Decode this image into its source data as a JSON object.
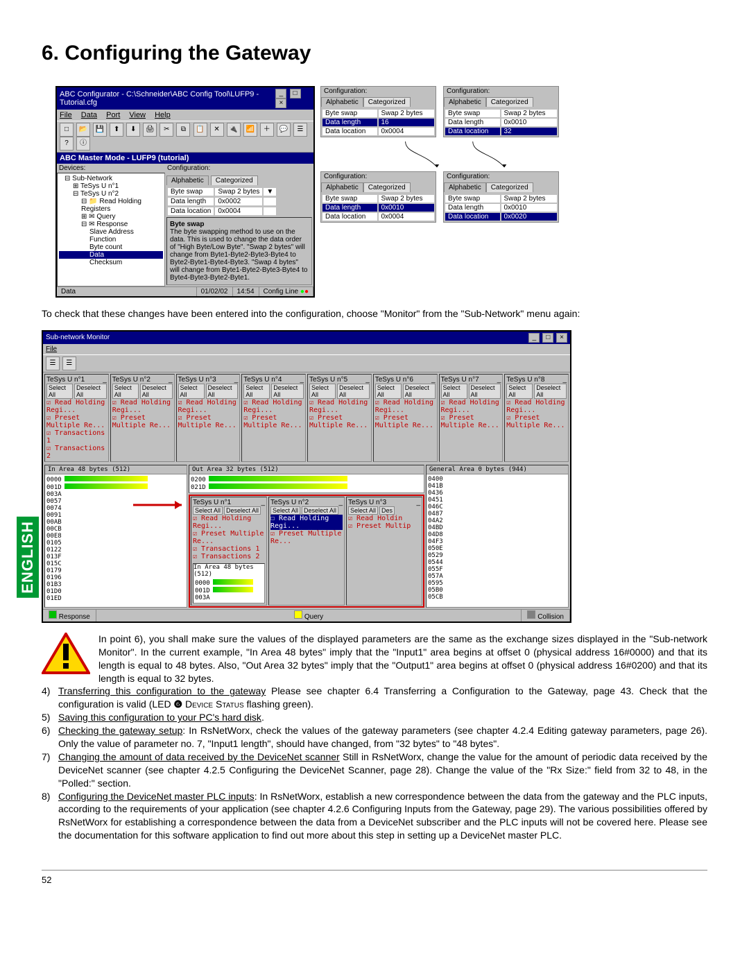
{
  "page": {
    "title": "6. Configuring the Gateway",
    "number": "52",
    "tab": "ENGLISH"
  },
  "abc_window": {
    "title": "ABC Configurator - C:\\Schneider\\ABC Config Tool\\LUFP9 - Tutorial.cfg",
    "menu": [
      "File",
      "Data",
      "Port",
      "View",
      "Help"
    ],
    "mode": "ABC Master Mode - LUFP9 (tutorial)",
    "devices_header": "Devices:",
    "config_header": "Configuration:",
    "tree": {
      "root": "Sub-Network",
      "n1": "TeSys U n°1",
      "n2": "TeSys U n°2",
      "rhr": "Read Holding Registers",
      "query": "Query",
      "response": "Response",
      "slave": "Slave Address",
      "func": "Function",
      "bytecount": "Byte count",
      "data": "Data",
      "checksum": "Checksum"
    },
    "tabs": {
      "a": "Alphabetic",
      "b": "Categorized"
    },
    "kv": {
      "k1": "Byte swap",
      "v1": "Swap 2 bytes",
      "k2": "Data length",
      "v2": "0x0002",
      "k3": "Data location",
      "v3": "0x0004"
    },
    "desc_title": "Byte swap",
    "desc_text": "The byte swapping method to use on the data. This is used to change the data order of \"High Byte/Low Byte\". \"Swap 2 bytes\" will change from Byte1-Byte2-Byte3-Byte4 to Byte2-Byte1-Byte4-Byte3. \"Swap 4 bytes\" will change from Byte1-Byte2-Byte3-Byte4 to Byte4-Byte3-Byte2-Byte1.",
    "status": {
      "left": "Data",
      "date": "01/02/02",
      "time": "14:54",
      "right": "Config Line"
    }
  },
  "minis": [
    {
      "hdr": "Configuration:",
      "byte_swap": "Swap 2 bytes",
      "data_length": "16",
      "data_location": "0x0004",
      "highlight": "data_length"
    },
    {
      "hdr": "Configuration:",
      "byte_swap": "Swap 2 bytes",
      "data_length": "0x0010",
      "data_location": "32",
      "highlight": "data_location"
    },
    {
      "hdr": "Configuration:",
      "byte_swap": "Swap 2 bytes",
      "data_length": "0x0010",
      "data_location": "0x0004",
      "highlight": "data_length"
    },
    {
      "hdr": "Configuration:",
      "byte_swap": "Swap 2 bytes",
      "data_length": "0x0010",
      "data_location": "0x0020",
      "highlight": "data_location"
    }
  ],
  "mini_labels": {
    "byte_swap": "Byte swap",
    "data_length": "Data length",
    "data_location": "Data location"
  },
  "intro_text": "To check that these changes have been entered into the configuration, choose \"Monitor\" from the \"Sub-Network\" menu again:",
  "monitor": {
    "title": "Sub-network Monitor",
    "menu": [
      "File"
    ],
    "colnames": [
      "TeSys U n°1",
      "TeSys U n°2",
      "TeSys U n°3",
      "TeSys U n°4",
      "TeSys U n°5",
      "TeSys U n°6",
      "TeSys U n°7",
      "TeSys U n°8"
    ],
    "select_all": "Select All",
    "deselect_all": "Deselect All",
    "items": {
      "rhr": "Read Holding Regi...",
      "pmr": "Preset Multiple Re...",
      "t1": "Transactions 1",
      "t2": "Transactions 2"
    },
    "lower": {
      "in_hdr": "In Area 48 bytes (512)",
      "out_hdr": "Out Area 32 bytes (512)",
      "gen_hdr": "General Area 0 bytes (944)",
      "in_addrs": [
        "0000",
        "001D",
        "003A",
        "0057",
        "0074",
        "0091",
        "00AB",
        "00CB",
        "00E8",
        "0105",
        "0122",
        "013F",
        "015C",
        "0179",
        "0196",
        "01B3",
        "01D0",
        "01ED"
      ],
      "out_addrs": [
        "0200",
        "021D"
      ],
      "gen_addrs": [
        "0400",
        "041B",
        "0436",
        "0451",
        "046C",
        "0487",
        "04A2",
        "04BD",
        "04D8",
        "04F3",
        "050E",
        "0529",
        "0544",
        "055F",
        "057A",
        "0595",
        "05B0",
        "05CB"
      ]
    },
    "highlight_cols": [
      "TeSys U n°1",
      "TeSys U n°2",
      "TeSys U n°3"
    ],
    "highlight_inner": {
      "in_hdr": "In Area 48 bytes (512)",
      "in_addrs": [
        "0000",
        "001D",
        "003A"
      ]
    },
    "status": {
      "response": "Response",
      "query": "Query",
      "collision": "Collision"
    }
  },
  "point6_text": "In point 6), you shall make sure the values of the displayed parameters are the same as the exchange sizes displayed in the \"Sub-network Monitor\". In the current example, \"In Area 48 bytes\" imply that the \"Input1\" area begins at offset 0 (physical address 16#0000) and that its length is equal to 48 bytes. Also, \"Out Area 32 bytes\" imply that the \"Output1\" area begins at offset 0 (physical address 16#0200) and that its length is equal to 32 bytes.",
  "steps": {
    "s4a": "Transferring this configuration to the gateway",
    "s4b": " Please see chapter 6.4 Transferring  a Configuration to the Gateway, page 43. Check that the configuration is valid (LED ",
    "s4c": " Device Status",
    "s4d": " flashing green).",
    "s5": "Saving this configuration to your PC's hard disk",
    "s6a": "Checking the gateway setup",
    "s6b": ": In RsNetWorx, check the values of the gateway parameters (see chapter 4.2.4 Editing gateway parameters, page 26). Only the value of parameter no. 7, \"Input1 length\", should have changed, from \"32 bytes\" to \"48 bytes\".",
    "s7a": "Changing the amount of data received by the DeviceNet scanner",
    "s7b": " Still in RsNetWorx, change the value for the amount of periodic data received by the DeviceNet scanner (see chapter 4.2.5 Configuring the DeviceNet Scanner, page 28). Change the value of the \"Rx Size:\" field from 32 to 48, in the \"Polled:\" section.",
    "s8a": "Configuring the DeviceNet master PLC inputs",
    "s8b": ": In RsNetWorx, establish a new correspondence between the data from the gateway and the PLC inputs, according to the requirements of your application (see chapter 4.2.6 Configuring Inputs from the Gateway, page 29). The various possibilities offered by RsNetWorx for establishing a correspondence between the data from a DeviceNet subscriber and the PLC inputs will not be covered here. Please see the documentation for this software application to find out more about this step in setting up a DeviceNet master PLC."
  }
}
